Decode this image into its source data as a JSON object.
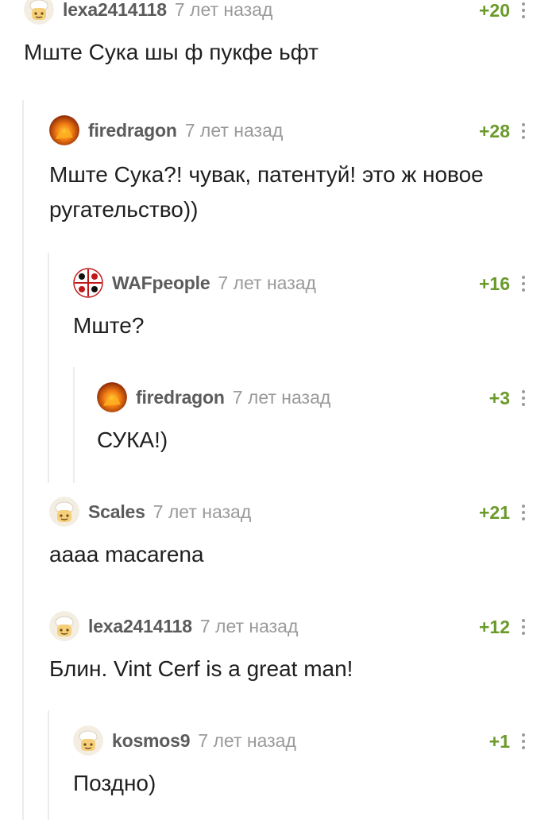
{
  "comments": [
    {
      "username": "lexa2414118",
      "time": "7 лет назад",
      "rating": "+20",
      "text": "Мште Сука шы ф пукфе ьфт",
      "avatar": "chef-avatar"
    },
    {
      "username": "firedragon",
      "time": "7 лет назад",
      "rating": "+28",
      "text": "Мште Сука?! чувак, патентуй! это ж новое ругательство))",
      "avatar": "fire-avatar"
    },
    {
      "username": "WAFpeople",
      "time": "7 лет назад",
      "rating": "+16",
      "text": "Мште?",
      "avatar": "waf-logo-avatar"
    },
    {
      "username": "firedragon",
      "time": "7 лет назад",
      "rating": "+3",
      "text": "СУКА!)",
      "avatar": "fire-avatar"
    },
    {
      "username": "Scales",
      "time": "7 лет назад",
      "rating": "+21",
      "text": "аааа macarena",
      "avatar": "chef-avatar"
    },
    {
      "username": "lexa2414118",
      "time": "7 лет назад",
      "rating": "+12",
      "text": "Блин. Vint Cerf is a great man!",
      "avatar": "chef-avatar"
    },
    {
      "username": "kosmos9",
      "time": "7 лет назад",
      "rating": "+1",
      "text": "Поздно)",
      "avatar": "chef-avatar"
    }
  ]
}
